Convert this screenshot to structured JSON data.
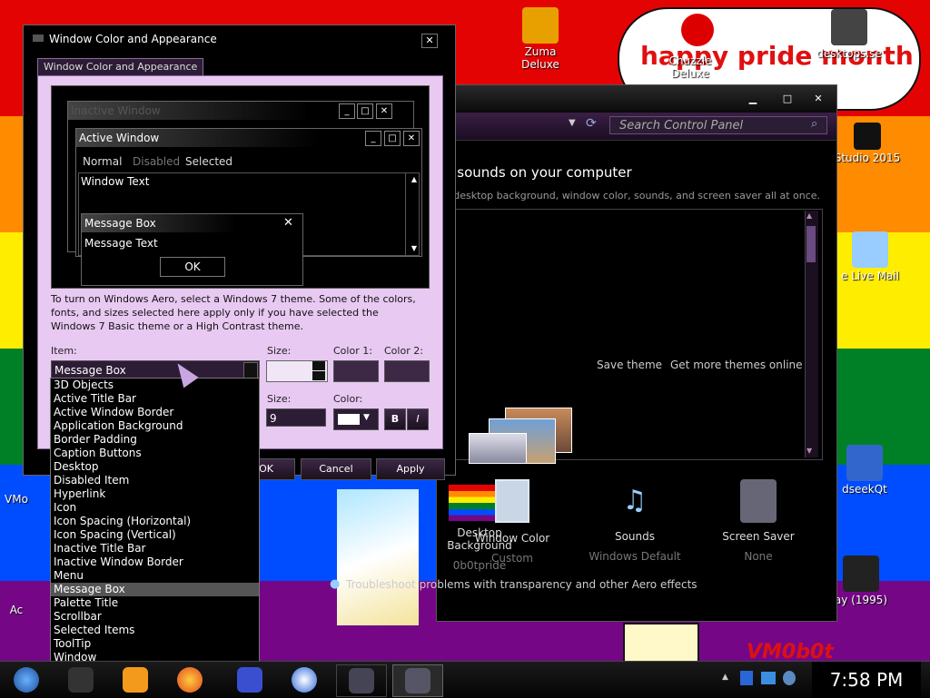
{
  "desktop": {
    "banner": "happy pride month",
    "watermark": "VM0b0t",
    "icons": [
      {
        "label": "Zuma Deluxe"
      },
      {
        "label": "Chuzzle Deluxe"
      },
      {
        "label": "desktops.se"
      },
      {
        "label": "Studio 2015"
      },
      {
        "label": "e Live Mail"
      },
      {
        "label": "VMo"
      },
      {
        "label": "Ac"
      },
      {
        "label": "dseekQt"
      },
      {
        "label": "ay (1995)"
      }
    ]
  },
  "control_panel": {
    "search_placeholder": "Search Control Panel",
    "heading": "d sounds on your computer",
    "subheading": "e desktop background, window color, sounds, and screen saver all at once.",
    "save_theme": "Save theme",
    "get_more": "Get more themes online",
    "items": [
      {
        "label": "Desktop Background",
        "value": "0b0tpride"
      },
      {
        "label": "Window Color",
        "value": "Custom"
      },
      {
        "label": "Sounds",
        "value": "Windows Default"
      },
      {
        "label": "Screen Saver",
        "value": "None"
      }
    ],
    "troubleshoot": "Troubleshoot problems with transparency and other Aero effects"
  },
  "dialog": {
    "title": "Window Color and Appearance",
    "tab": "Window Color and Appearance",
    "preview": {
      "inactive_title": "Inactive Window",
      "active_title": "Active Window",
      "menu": [
        "Normal",
        "Disabled",
        "Selected"
      ],
      "window_text": "Window Text",
      "msgbox_title": "Message Box",
      "msgbox_text": "Message Text",
      "ok": "OK"
    },
    "note": "To turn on Windows Aero, select a Windows 7 theme.  Some of the colors, fonts, and sizes selected here apply only if you have selected the Windows 7 Basic theme or a High Contrast theme.",
    "item_label": "Item:",
    "item_value": "Message Box",
    "size_label": "Size:",
    "color1_label": "Color 1:",
    "color2_label": "Color 2:",
    "font_size_label": "Size:",
    "font_size_value": "9",
    "color_label": "Color:",
    "bold": "B",
    "italic": "I",
    "buttons": {
      "ok": "OK",
      "cancel": "Cancel",
      "apply": "Apply"
    },
    "item_options": [
      "3D Objects",
      "Active Title Bar",
      "Active Window Border",
      "Application Background",
      "Border Padding",
      "Caption Buttons",
      "Desktop",
      "Disabled Item",
      "Hyperlink",
      "Icon",
      "Icon Spacing (Horizontal)",
      "Icon Spacing (Vertical)",
      "Inactive Title Bar",
      "Inactive Window Border",
      "Menu",
      "Message Box",
      "Palette Title",
      "Scrollbar",
      "Selected Items",
      "ToolTip",
      "Window"
    ]
  },
  "taskbar": {
    "clock": "7:58 PM"
  }
}
